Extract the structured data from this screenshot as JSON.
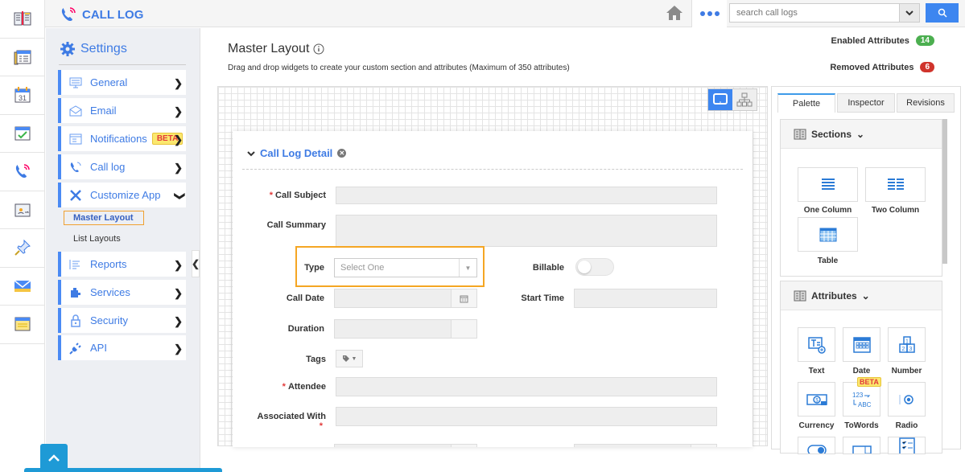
{
  "app": {
    "title": "CALL LOG"
  },
  "rail": {
    "icons": [
      "book-icon",
      "contacts-icon",
      "calendar-icon",
      "task-icon",
      "call-log-icon",
      "folder-user-icon",
      "pin-icon",
      "mail-icon",
      "notes-icon"
    ],
    "calendar_day": "31"
  },
  "topbar": {
    "search_placeholder": "search call logs"
  },
  "sidebar": {
    "heading": "Settings",
    "items": [
      {
        "label": "General",
        "icon": "monitor-icon"
      },
      {
        "label": "Email",
        "icon": "envelope-icon"
      },
      {
        "label": "Notifications",
        "icon": "notification-icon",
        "badge": "BETA"
      },
      {
        "label": "Call log",
        "icon": "phone-icon"
      },
      {
        "label": "Customize App",
        "icon": "tools-icon",
        "expanded": true
      },
      {
        "label": "Reports",
        "icon": "reports-icon"
      },
      {
        "label": "Services",
        "icon": "puzzle-icon"
      },
      {
        "label": "Security",
        "icon": "lock-icon"
      },
      {
        "label": "API",
        "icon": "plug-icon"
      }
    ],
    "subitems": [
      {
        "label": "Master Layout",
        "active": true
      },
      {
        "label": "List Layouts",
        "active": false
      }
    ]
  },
  "main": {
    "title": "Master Layout",
    "description": "Drag and drop widgets to create your custom section and attributes (Maximum of 350 attributes)",
    "enabled_label": "Enabled Attributes",
    "enabled_count": "14",
    "removed_label": "Removed Attributes",
    "removed_count": "6",
    "colors": {
      "enabled": "#4caf50",
      "removed": "#d0342c",
      "accent": "#3e7be4",
      "highlight": "#f5a623"
    }
  },
  "form": {
    "section_title": "Call Log Detail",
    "fields": {
      "call_subject": "Call Subject",
      "call_summary": "Call Summary",
      "type": "Type",
      "type_placeholder": "Select One",
      "billable": "Billable",
      "billable_on": false,
      "call_date": "Call Date",
      "start_time": "Start Time",
      "duration": "Duration",
      "tags": "Tags",
      "attendee": "Attendee",
      "associated_with": "Associated With"
    },
    "required_mark": "*"
  },
  "palette": {
    "tabs": [
      "Palette",
      "Inspector",
      "Revisions"
    ],
    "active_tab": "Palette",
    "sections_title": "Sections",
    "sections": [
      "One Column",
      "Two Column",
      "Table"
    ],
    "attributes_title": "Attributes",
    "attributes": [
      "Text",
      "Date",
      "Number",
      "Currency",
      "ToWords",
      "Radio"
    ],
    "towords_badge": "BETA"
  }
}
